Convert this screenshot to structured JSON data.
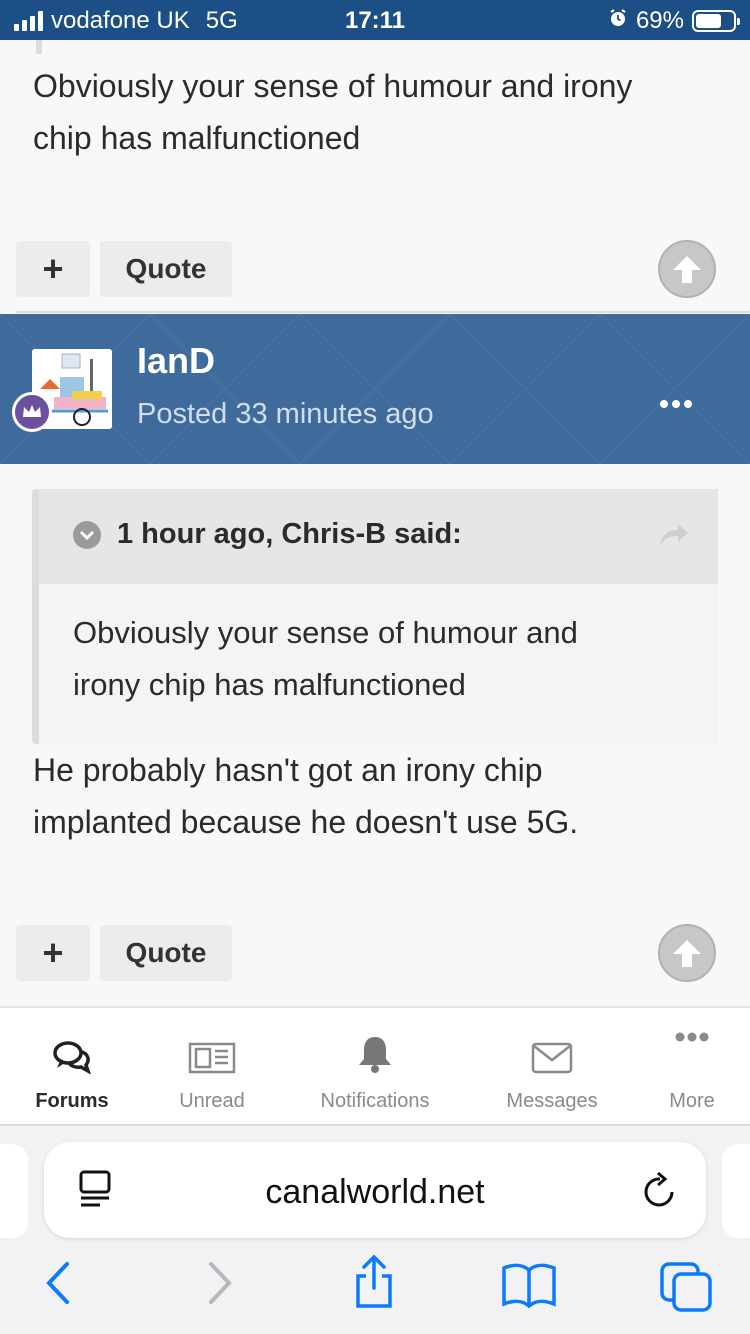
{
  "status_bar": {
    "carrier": "vodafone UK",
    "network": "5G",
    "time": "17:11",
    "battery": "69%",
    "battery_level": 0.69
  },
  "previous_post": {
    "text_lines": [
      "Obviously your sense of humour and irony",
      "chip has malfunctioned"
    ],
    "plus_label": "+",
    "quote_label": "Quote"
  },
  "post": {
    "author": "IanD",
    "posted": "Posted 33 minutes ago",
    "quote": {
      "citation": "1 hour ago, Chris-B said:",
      "text_lines": [
        "Obviously your sense of humour and",
        "irony chip has malfunctioned"
      ]
    },
    "body_lines": [
      "He probably hasn't got an irony chip",
      "implanted because he doesn't use 5G."
    ],
    "plus_label": "+",
    "quote_label": "Quote"
  },
  "bottom_nav": {
    "items": [
      {
        "label": "Forums",
        "icon": "forums-icon",
        "active": true
      },
      {
        "label": "Unread",
        "icon": "newspaper-icon",
        "active": false
      },
      {
        "label": "Notifications",
        "icon": "bell-icon",
        "active": false
      },
      {
        "label": "Messages",
        "icon": "envelope-icon",
        "active": false
      },
      {
        "label": "More",
        "icon": "more-dots-icon",
        "active": false
      }
    ]
  },
  "browser": {
    "url": "canalworld.net"
  },
  "colors": {
    "status_bar": "#1c4f86",
    "author_header": "#3e6a9c",
    "safari_blue": "#0a7aff"
  }
}
